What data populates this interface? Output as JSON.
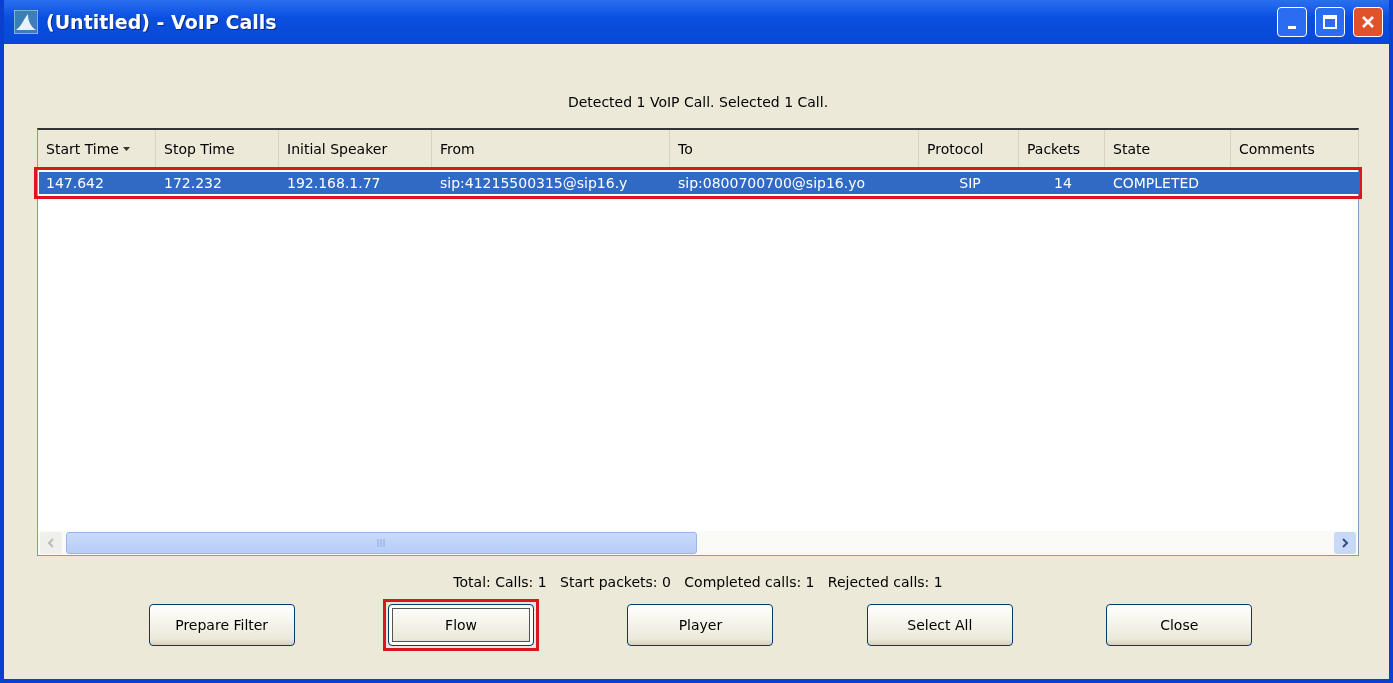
{
  "window": {
    "title": "(Untitled) - VoIP Calls"
  },
  "summary": "Detected 1 VoIP Call. Selected 1 Call.",
  "table": {
    "columns": [
      {
        "label": "Start Time",
        "sorted": true
      },
      {
        "label": "Stop Time",
        "sorted": false
      },
      {
        "label": "Initial Speaker",
        "sorted": false
      },
      {
        "label": "From",
        "sorted": false
      },
      {
        "label": "To",
        "sorted": false
      },
      {
        "label": "Protocol",
        "sorted": false
      },
      {
        "label": "Packets",
        "sorted": false
      },
      {
        "label": "State",
        "sorted": false
      },
      {
        "label": "Comments",
        "sorted": false
      }
    ],
    "rows": [
      {
        "selected": true,
        "highlighted": true,
        "cells": [
          "147.642",
          "172.232",
          "192.168.1.77",
          "sip:41215500315@sip16.y",
          "sip:0800700700@sip16.yo",
          "SIP",
          "14",
          "COMPLETED",
          null
        ]
      }
    ]
  },
  "stats": "Total: Calls: 1   Start packets: 0   Completed calls: 1   Rejected calls: 1",
  "buttons": [
    {
      "label": "Prepare Filter",
      "focused": false,
      "highlighted": false
    },
    {
      "label": "Flow",
      "focused": true,
      "highlighted": true
    },
    {
      "label": "Player",
      "focused": false,
      "highlighted": false
    },
    {
      "label": "Select All",
      "focused": false,
      "highlighted": false
    },
    {
      "label": "Close",
      "focused": false,
      "highlighted": false
    }
  ]
}
